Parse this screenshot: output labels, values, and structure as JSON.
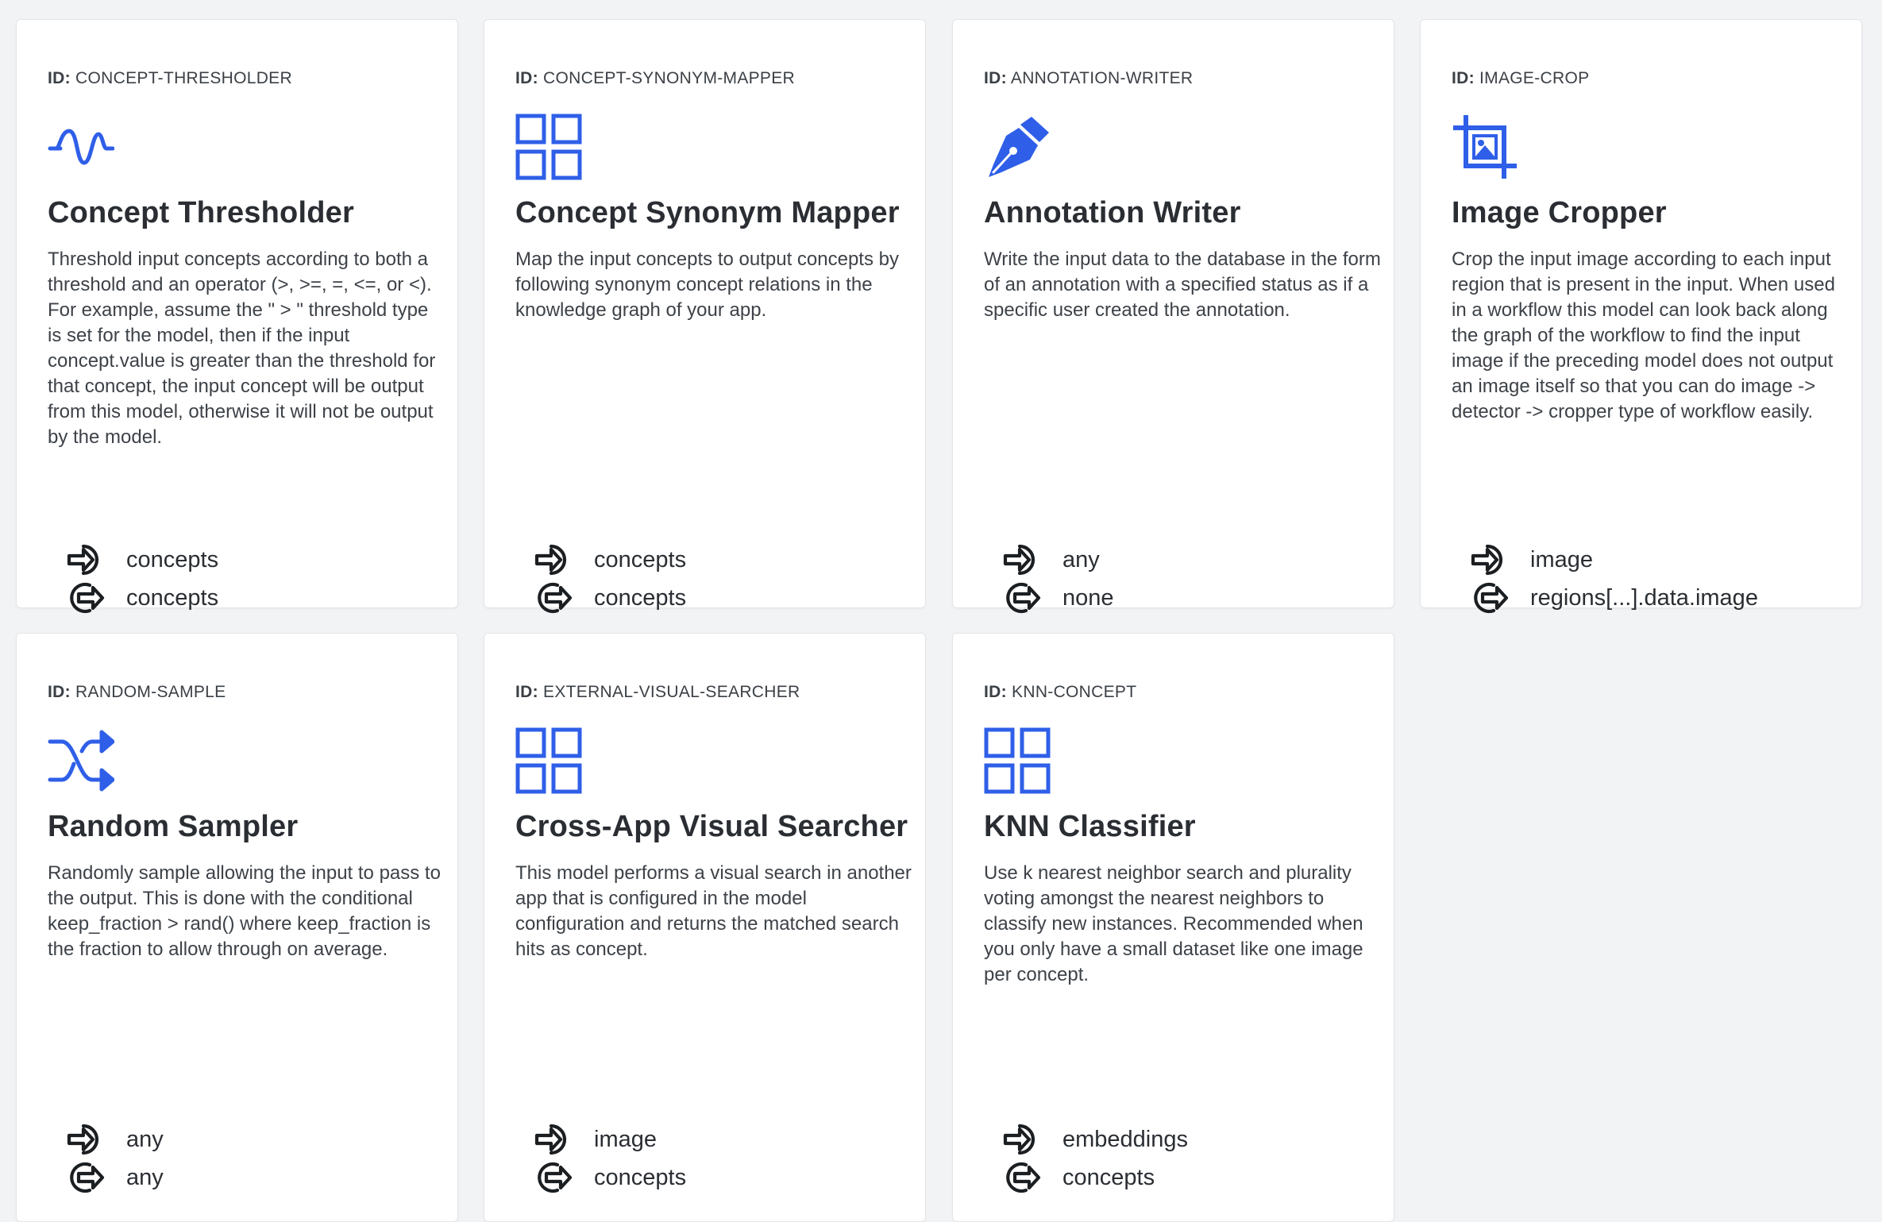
{
  "accent_color": "#2f5fe8",
  "id_prefix": "ID:",
  "cards": [
    {
      "id": "CONCEPT-THRESHOLDER",
      "icon": "threshold-wave-icon",
      "title": "Concept Thresholder",
      "description": "Threshold input concepts according to both a threshold and an operator (>, >=, =, <=, or <). For example, assume the \" > \" threshold type is set for the model, then if the input concept.value is greater than the threshold for that concept, the input concept will be output from this model, otherwise it will not be output by the model.",
      "input": "concepts",
      "output": "concepts"
    },
    {
      "id": "CONCEPT-SYNONYM-MAPPER",
      "icon": "grid-squares-icon",
      "title": "Concept Synonym Mapper",
      "description": "Map the input concepts to output concepts by following synonym concept relations in the knowledge graph of your app.",
      "input": "concepts",
      "output": "concepts"
    },
    {
      "id": "ANNOTATION-WRITER",
      "icon": "pen-nib-icon",
      "title": "Annotation Writer",
      "description": "Write the input data to the database in the form of an annotation with a specified status as if a specific user created the annotation.",
      "input": "any",
      "output": "none"
    },
    {
      "id": "IMAGE-CROP",
      "icon": "crop-image-icon",
      "title": "Image Cropper",
      "description": "Crop the input image according to each input region that is present in the input. When used in a workflow this model can look back along the graph of the workflow to find the input image if the preceding model does not output an image itself so that you can do image -> detector -> cropper type of workflow easily.",
      "input": "image",
      "output": "regions[...].data.image"
    },
    {
      "id": "RANDOM-SAMPLE",
      "icon": "shuffle-icon",
      "title": "Random Sampler",
      "description": "Randomly sample allowing the input to pass to the output. This is done with the conditional keep_fraction > rand() where keep_fraction is the fraction to allow through on average.",
      "input": "any",
      "output": "any"
    },
    {
      "id": "EXTERNAL-VISUAL-SEARCHER",
      "icon": "grid-squares-icon",
      "title": "Cross-App Visual Searcher",
      "description": "This model performs a visual search in another app that is configured in the model configuration and returns the matched search hits as concept.",
      "input": "image",
      "output": "concepts"
    },
    {
      "id": "KNN-CONCEPT",
      "icon": "grid-squares-icon",
      "title": "KNN Classifier",
      "description": "Use k nearest neighbor search and plurality voting amongst the nearest neighbors to classify new instances. Recommended when you only have a small dataset like one image per concept.",
      "input": "embeddings",
      "output": "concepts"
    }
  ]
}
